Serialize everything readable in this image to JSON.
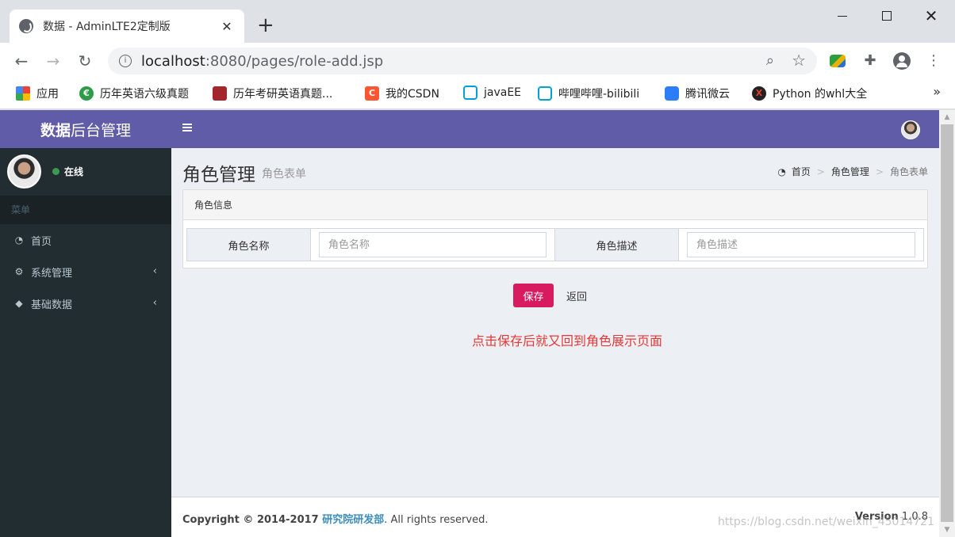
{
  "browser": {
    "tab_title": "数据 - AdminLTE2定制版",
    "tab_close": "✕",
    "new_tab": "+",
    "url_host": "localhost",
    "url_rest": ":8080/pages/role-add.jsp",
    "bookmarks": [
      {
        "label": "应用",
        "icon": "apps-grid-icon"
      },
      {
        "label": "历年英语六级真题",
        "icon": "leaf-icon"
      },
      {
        "label": "历年考研英语真题...",
        "icon": "book-icon"
      },
      {
        "label": "我的CSDN",
        "icon": "csdn-icon"
      },
      {
        "label": "javaEE",
        "icon": "bilibili-icon"
      },
      {
        "label": "哔哩哔哩-bilibili",
        "icon": "bilibili-icon"
      },
      {
        "label": "腾讯微云",
        "icon": "weiyun-icon"
      },
      {
        "label": "Python 的whl大全",
        "icon": "python-whl-icon"
      }
    ],
    "bookmarks_more": "»"
  },
  "header": {
    "logo_bold": "数据",
    "logo_rest": "后台管理"
  },
  "sidebar": {
    "status": "在线",
    "menu_header": "菜单",
    "items": [
      {
        "label": "首页",
        "icon": "dashboard-icon"
      },
      {
        "label": "系统管理",
        "icon": "cogs-icon"
      },
      {
        "label": "基础数据",
        "icon": "cube-icon"
      }
    ]
  },
  "content": {
    "title": "角色管理",
    "subtitle": "角色表单",
    "breadcrumb": [
      "首页",
      "角色管理",
      "角色表单"
    ],
    "panel_title": "角色信息",
    "fields": [
      {
        "label": "角色名称",
        "value": "",
        "placeholder": "角色名称"
      },
      {
        "label": "角色描述",
        "value": "",
        "placeholder": "角色描述"
      }
    ],
    "save_label": "保存",
    "back_label": "返回",
    "note": "点击保存后就又回到角色展示页面"
  },
  "footer": {
    "copyright_prefix": "Copyright © 2014-2017 ",
    "org": "研究院研发部",
    "suffix": ". All rights reserved.",
    "version_label": "Version",
    "version": " 1.0.8",
    "watermark": "https://blog.csdn.net/weixin_45014721"
  },
  "colors": {
    "primary": "#605ca8",
    "sidebar": "#222d32",
    "save_button": "#d81b60",
    "note": "#e53935",
    "link": "#3c8dbc"
  }
}
